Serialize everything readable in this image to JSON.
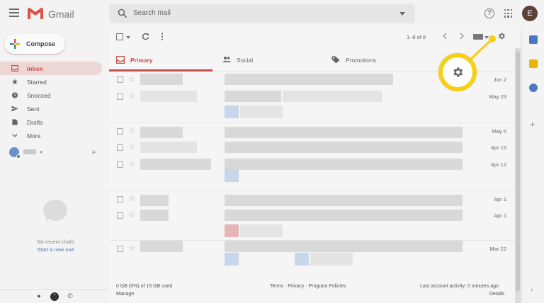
{
  "header": {
    "app_name": "Gmail",
    "search_placeholder": "Search mail",
    "avatar_initial": "E"
  },
  "compose": {
    "label": "Compose"
  },
  "sidebar": {
    "items": [
      {
        "label": "Inbox",
        "icon": "inbox-icon",
        "active": true
      },
      {
        "label": "Starred",
        "icon": "star-icon"
      },
      {
        "label": "Snoozed",
        "icon": "clock-icon"
      },
      {
        "label": "Sent",
        "icon": "send-icon"
      },
      {
        "label": "Drafts",
        "icon": "draft-icon"
      },
      {
        "label": "More",
        "icon": "chevron-down-icon"
      }
    ]
  },
  "chat": {
    "empty_text": "No recent chats",
    "start_link": "Start a new one"
  },
  "toolbar": {
    "pagination": "1–8 of 8"
  },
  "tabs": [
    {
      "label": "Primary",
      "icon": "inbox-icon",
      "active": true
    },
    {
      "label": "Social",
      "icon": "people-icon"
    },
    {
      "label": "Promotions",
      "icon": "tag-icon"
    }
  ],
  "emails": [
    {
      "date": "Jun 2"
    },
    {
      "date": "May 23"
    },
    {
      "date": "May 5"
    },
    {
      "date": "Apr 15"
    },
    {
      "date": "Apr 12"
    },
    {
      "date": "Apr 1"
    },
    {
      "date": "Apr 1"
    },
    {
      "date": "Mar 22"
    }
  ],
  "footer": {
    "storage": "0 GB (0%) of 15 GB used",
    "manage": "Manage",
    "links": "Terms · Privacy · Program Policies",
    "activity": "Last account activity: 0 minutes ago",
    "details": "Details"
  },
  "colors": {
    "accent_red": "#c5504a",
    "highlight_yellow": "#f6cf16",
    "link_blue": "#4a78c3"
  }
}
